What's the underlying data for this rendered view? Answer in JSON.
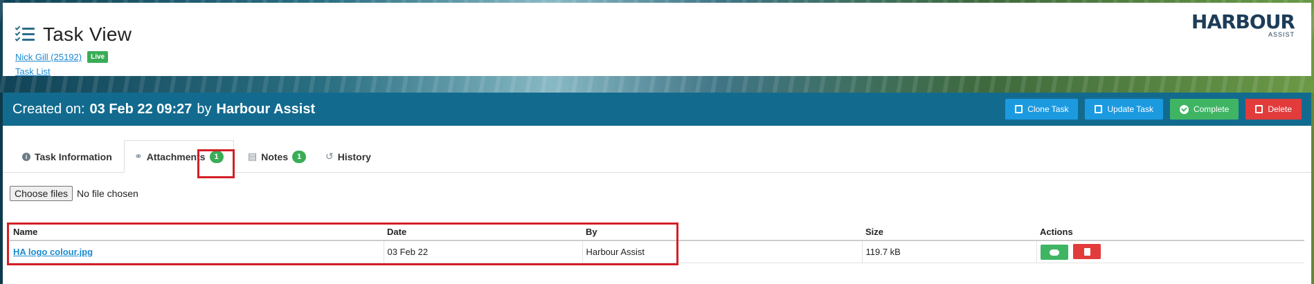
{
  "header": {
    "title": "Task View",
    "customer_link": "Nick Gill (25192)",
    "status_badge": "Live",
    "task_list_link": "Task List",
    "logo_brand": "HARBOUR",
    "logo_sub": "ASSIST"
  },
  "task": {
    "created_label": "Created on:",
    "created_date": "03 Feb 22 09:27",
    "by_label": "by",
    "created_by": "Harbour Assist"
  },
  "toolbar": {
    "clone_label": "Clone Task",
    "update_label": "Update Task",
    "complete_label": "Complete",
    "delete_label": "Delete"
  },
  "tabs": [
    {
      "label": "Task Information",
      "icon": "info-icon"
    },
    {
      "label": "Attachments",
      "icon": "paperclip-icon",
      "count": "1"
    },
    {
      "label": "Notes",
      "icon": "document-icon",
      "count": "1"
    },
    {
      "label": "History",
      "icon": "history-icon"
    }
  ],
  "upload": {
    "button_label": "Choose files",
    "status": "No file chosen"
  },
  "attachments": {
    "columns": [
      "Name",
      "Date",
      "By",
      "Size",
      "Actions"
    ],
    "rows": [
      {
        "name": "HA logo colour.jpg",
        "date": "03 Feb 22",
        "by": "Harbour Assist",
        "size": "119.7 kB"
      }
    ]
  },
  "colors": {
    "panel_header": "#126b8f",
    "accent_blue": "#1c9ae0",
    "success_green": "#3fb564",
    "danger_red": "#e23b3b",
    "highlight_red": "#d31f26"
  }
}
